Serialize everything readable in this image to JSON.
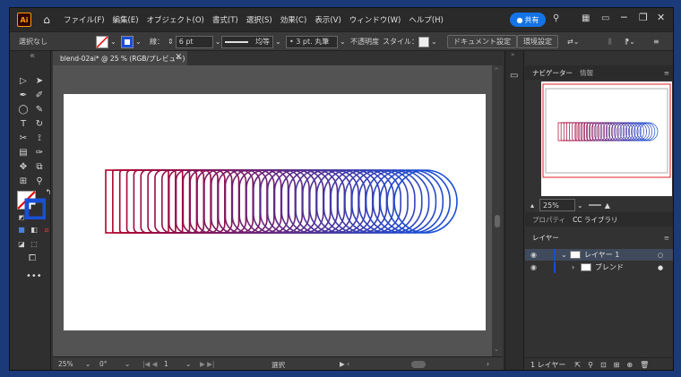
{
  "app": {
    "logo": "Ai",
    "home_icon": "home-icon"
  },
  "menu": [
    "ファイル(F)",
    "編集(E)",
    "オブジェクト(O)",
    "書式(T)",
    "選択(S)",
    "効果(C)",
    "表示(V)",
    "ウィンドウ(W)",
    "ヘルプ(H)"
  ],
  "share": {
    "label": "共有"
  },
  "control": {
    "selection": "選択なし",
    "stroke_label": "線：",
    "stroke_value": "6 pt",
    "profile": "均等",
    "brush": "3 pt. 丸筆",
    "opacity": "不透明度",
    "style": "スタイル：",
    "doc_settings": "ドキュメント設定",
    "prefs": "環境設定"
  },
  "document": {
    "tab": "blend-02ai* @ 25 % (RGB/プレビュー)"
  },
  "status": {
    "zoom": "25%",
    "rotation": "0°",
    "page": "1",
    "tool": "選択"
  },
  "navigator": {
    "tab_nav": "ナビゲーター",
    "tab_info": "情報",
    "zoom": "25%"
  },
  "panels": {
    "props": "プロパティ",
    "cc": "CC ライブラリ",
    "layers_title": "レイヤー"
  },
  "layers": {
    "rows": [
      {
        "name": "レイヤー 1"
      },
      {
        "name": "ブレンド"
      }
    ],
    "count": "1 レイヤー"
  },
  "colors": {
    "blend_start": "#b0002a",
    "blend_end": "#1a4fd6",
    "accent": "#1473e6"
  }
}
